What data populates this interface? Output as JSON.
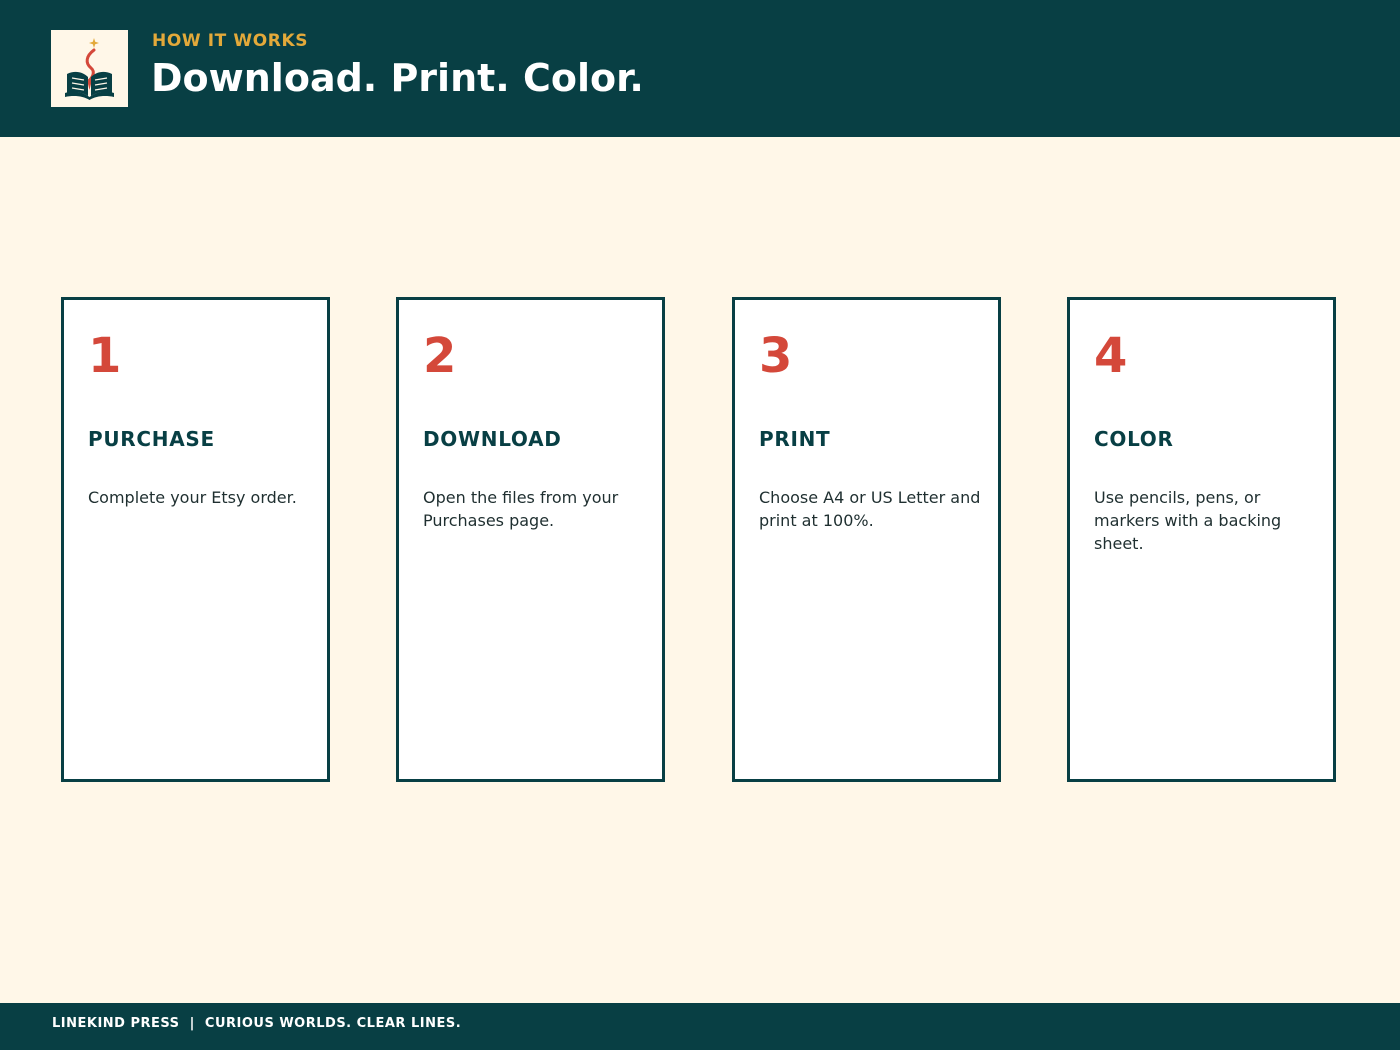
{
  "header": {
    "eyebrow": "HOW IT WORKS",
    "title": "Download. Print. Color."
  },
  "logo": {
    "icon": "open-book-quill-icon",
    "colors": {
      "book": "#083f44",
      "quill": "#d4483a",
      "star": "#e3a93a"
    }
  },
  "steps": [
    {
      "number": "1",
      "title": "PURCHASE",
      "description": "Complete your Etsy order."
    },
    {
      "number": "2",
      "title": "DOWNLOAD",
      "description": "Open the files from your Purchases page."
    },
    {
      "number": "3",
      "title": "PRINT",
      "description": "Choose A4 or US Letter and print at 100%."
    },
    {
      "number": "4",
      "title": "COLOR",
      "description": "Use pencils, pens, or markers with a backing sheet."
    }
  ],
  "footer": {
    "text": "LINEKIND PRESS  |  CURIOUS WORLDS. CLEAR LINES."
  },
  "colors": {
    "primary": "#083f44",
    "accent": "#d4483a",
    "gold": "#e3a93a",
    "background": "#fff7e8"
  }
}
